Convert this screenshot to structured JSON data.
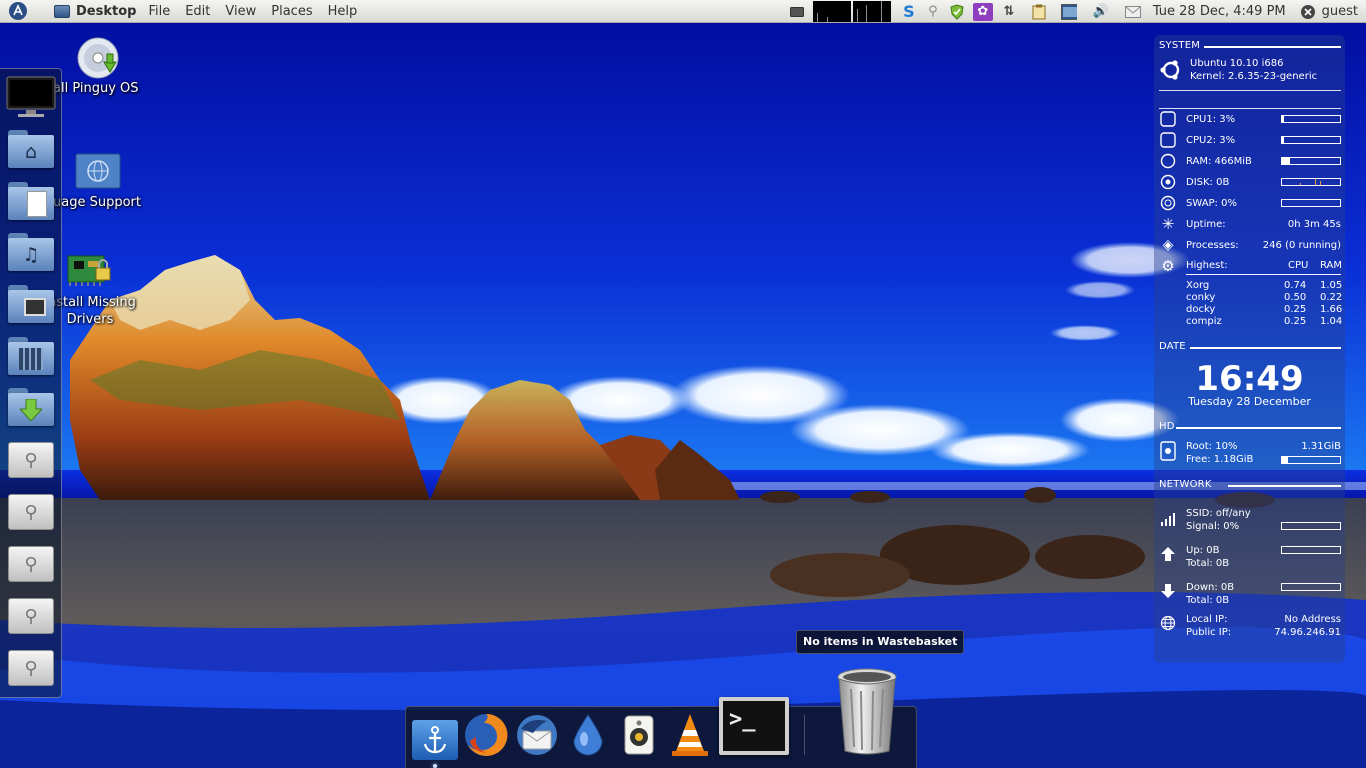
{
  "top_panel": {
    "app_name": "Desktop",
    "menus": [
      "File",
      "Edit",
      "View",
      "Places",
      "Help"
    ],
    "clock": "Tue 28 Dec,  4:49 PM",
    "user": "guest"
  },
  "desktop_icons": [
    {
      "label": "all Pinguy OS"
    },
    {
      "label": "uage Support"
    },
    {
      "label_line1": "Install Missing",
      "label_line2": "Drivers"
    }
  ],
  "left_dock": {
    "items": [
      "monitor-icon",
      "home-folder-icon",
      "documents-folder-icon",
      "music-folder-icon",
      "pictures-folder-icon",
      "videos-folder-icon",
      "downloads-folder-icon",
      "usb-drive-icon",
      "usb-drive-icon",
      "usb-drive-icon",
      "usb-drive-icon",
      "usb-drive-icon"
    ]
  },
  "conky": {
    "system": {
      "header": "SYSTEM",
      "os": "Ubuntu 10.10 i686",
      "kernel": "Kernel: 2.6.35-23-generic"
    },
    "resources": {
      "cpu1": {
        "label": "CPU1: 3%",
        "fraction": 0.03
      },
      "cpu2": {
        "label": "CPU2: 3%",
        "fraction": 0.03
      },
      "ram": {
        "label": "RAM: 466MiB",
        "fraction": 0.13
      },
      "disk": {
        "label": "DISK: 0B"
      },
      "swap": {
        "label": "SWAP: 0%",
        "fraction": 0.0
      },
      "uptime_label": "Uptime:",
      "uptime_value": "0h 3m 45s",
      "processes_label": "Processes:",
      "processes_value": "246 (0 running)",
      "highest_label": "Highest:",
      "cpu_col": "CPU",
      "ram_col": "RAM",
      "top_processes": [
        {
          "name": "Xorg",
          "cpu": "0.74",
          "ram": "1.05"
        },
        {
          "name": "conky",
          "cpu": "0.50",
          "ram": "0.22"
        },
        {
          "name": "docky",
          "cpu": "0.25",
          "ram": "1.66"
        },
        {
          "name": "compiz",
          "cpu": "0.25",
          "ram": "1.04"
        }
      ]
    },
    "date": {
      "header": "DATE",
      "time": "16:49",
      "date": "Tuesday 28 December"
    },
    "hd": {
      "header": "HD",
      "root_label": "Root: 10%",
      "root_size": "1.31GiB",
      "free_label": "Free: 1.18GiB",
      "fraction": 0.1
    },
    "network": {
      "header": "NETWORK",
      "ssid": "SSID: off/any",
      "signal": "Signal: 0%",
      "up": "Up: 0B",
      "up_total": "Total: 0B",
      "down": "Down: 0B",
      "down_total": "Total: 0B",
      "local_ip_label": "Local IP:",
      "local_ip": "No Address",
      "public_ip_label": "Public IP:",
      "public_ip": "74.96.246.91"
    }
  },
  "tooltip": "No items in Wastebasket",
  "bottom_dock": {
    "items": [
      "docky-anchor-icon",
      "firefox-icon",
      "thunderbird-icon",
      "deluge-icon",
      "rhythmbox-icon",
      "vlc-icon",
      "terminal-icon",
      "wastebasket-icon"
    ],
    "terminal_prompt": ">_"
  }
}
